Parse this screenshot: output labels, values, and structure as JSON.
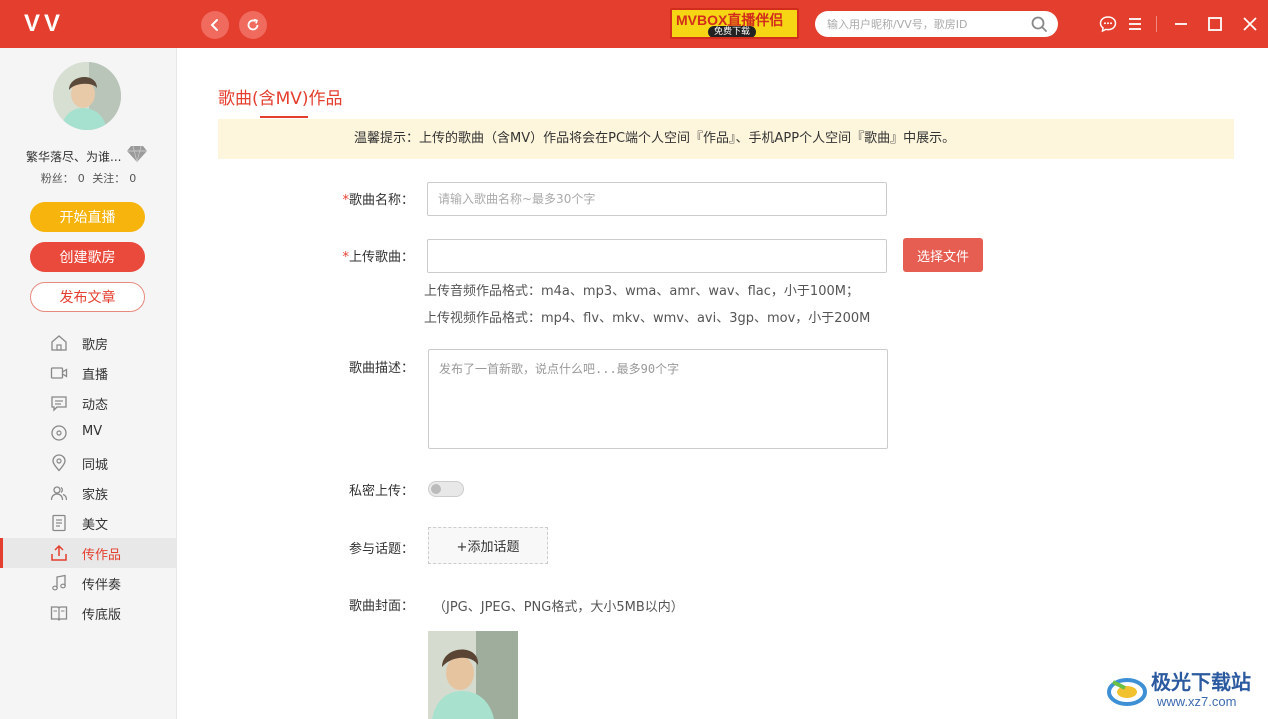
{
  "titlebar": {
    "logo": "VV",
    "banner_title": "MVBOX直播伴侣",
    "banner_sub": "免费下载",
    "search_placeholder": "输入用户昵称/VV号，歌房ID",
    "accent": "#e43e2e"
  },
  "sidebar": {
    "user_name": "繁华落尽、为谁...",
    "fans_label": "粉丝：",
    "fans_value": "0",
    "follow_label": "关注：",
    "follow_value": "0",
    "btn_live": "开始直播",
    "btn_room": "创建歌房",
    "btn_post": "发布文章",
    "items": [
      {
        "label": "歌房",
        "icon": "house-icon"
      },
      {
        "label": "直播",
        "icon": "video-camera-icon"
      },
      {
        "label": "动态",
        "icon": "message-icon"
      },
      {
        "label": "MV",
        "icon": "disc-icon"
      },
      {
        "label": "同城",
        "icon": "location-pin-icon"
      },
      {
        "label": "家族",
        "icon": "people-icon"
      },
      {
        "label": "美文",
        "icon": "document-icon"
      },
      {
        "label": "传作品",
        "icon": "upload-icon",
        "active": true
      },
      {
        "label": "传伴奏",
        "icon": "music-note-icon"
      },
      {
        "label": "传底版",
        "icon": "book-icon"
      }
    ]
  },
  "main": {
    "page_title": "歌曲(含MV)作品",
    "notice": "温馨提示：上传的歌曲（含MV）作品将会在PC端个人空间『作品』、手机APP个人空间『歌曲』中展示。",
    "song_name_label": "歌曲名称：",
    "song_name_placeholder": "请输入歌曲名称~最多30个字",
    "upload_label": "上传歌曲：",
    "upload_value": "",
    "choose_file": "选择文件",
    "audio_hint": "上传音频作品格式：m4a、mp3、wma、amr、wav、flac，小于100M；",
    "video_hint": "上传视频作品格式：mp4、flv、mkv、wmv、avi、3gp、mov，小于200M",
    "desc_label": "歌曲描述：",
    "desc_placeholder": "发布了一首新歌，说点什么吧...最多90个字",
    "private_label": "私密上传：",
    "private_on": false,
    "topic_label": "参与话题：",
    "topic_button": "+添加话题",
    "cover_label": "歌曲封面：",
    "cover_hint": "（JPG、JPEG、PNG格式，大小5MB以内）"
  },
  "watermark": {
    "text": "极光下载站",
    "url": "www.xz7.com"
  }
}
